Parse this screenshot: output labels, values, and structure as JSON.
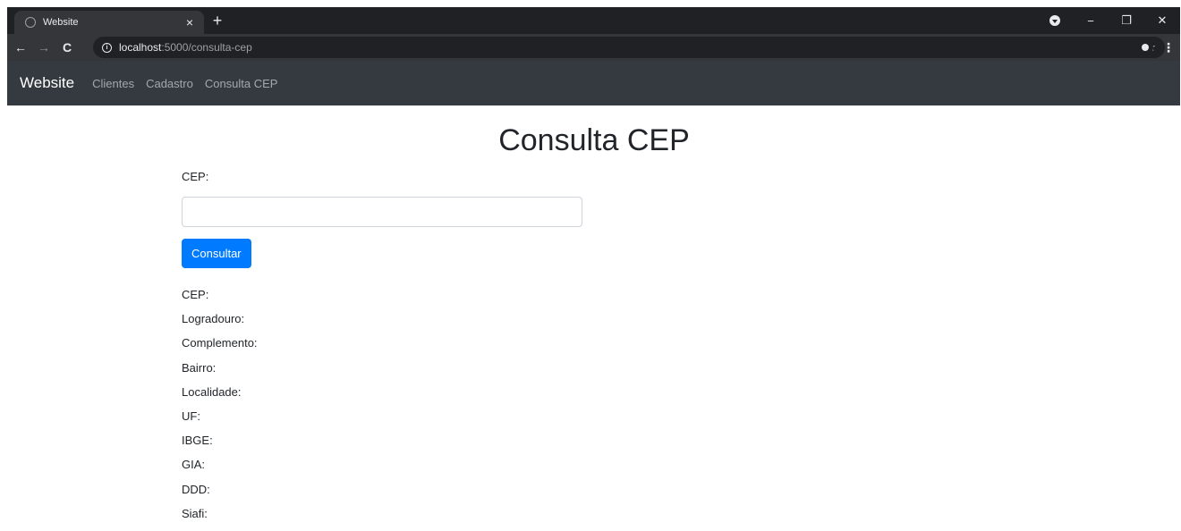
{
  "browser": {
    "tab_title": "Website",
    "tab_close": "×",
    "new_tab": "+",
    "window_controls": {
      "minimize": "−",
      "restore": "❐",
      "close": "✕"
    },
    "nav": {
      "back": "←",
      "forward": "→",
      "reload": "C"
    },
    "address": {
      "host": "localhost",
      "path": ":5000/consulta-cep"
    },
    "bookmark_star": "☆",
    "menu": "⋮"
  },
  "navbar": {
    "brand": "Website",
    "links": [
      "Clientes",
      "Cadastro",
      "Consulta CEP"
    ]
  },
  "page": {
    "title": "Consulta CEP",
    "form": {
      "label": "CEP:",
      "input_value": "",
      "button_label": "Consultar"
    },
    "results": [
      "CEP:",
      "Logradouro:",
      "Complemento:",
      "Bairro:",
      "Localidade:",
      "UF:",
      "IBGE:",
      "GIA:",
      "DDD:",
      "Siafi:"
    ]
  }
}
